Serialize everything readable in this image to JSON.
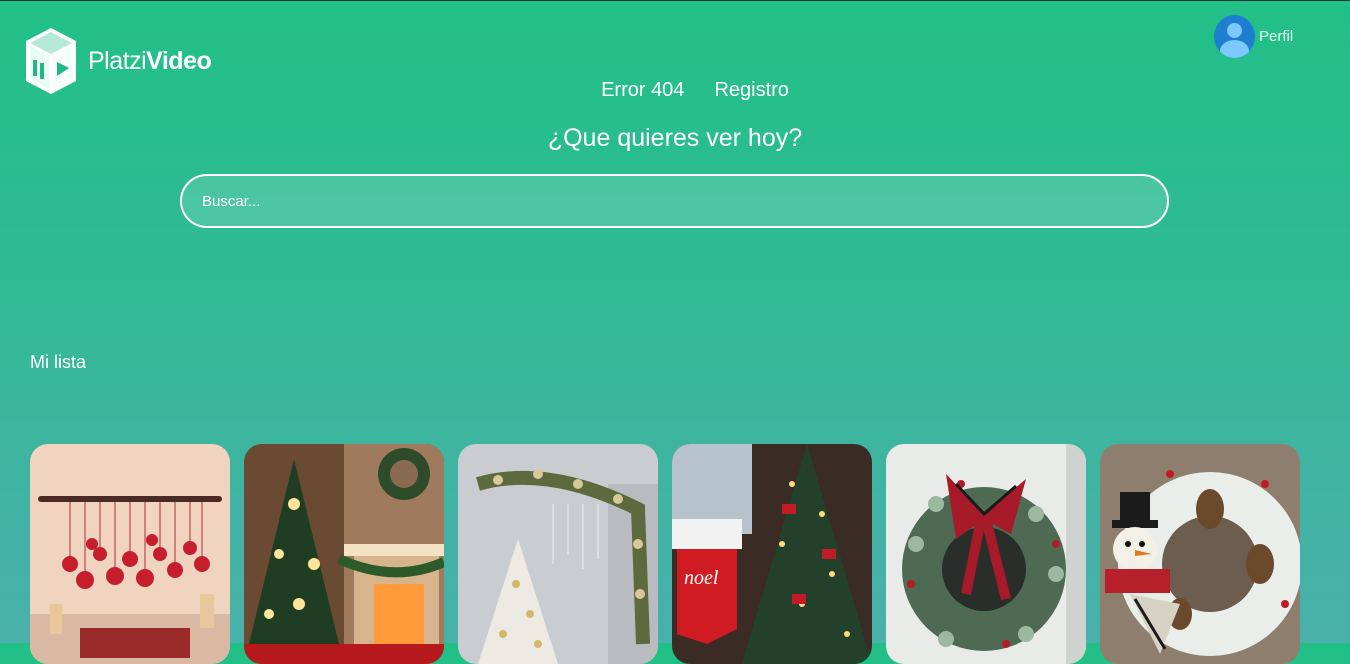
{
  "header": {
    "logo": {
      "text_light": "Platzi",
      "text_bold": "Video",
      "icon": "platzi-cube-icon"
    },
    "profile": {
      "label": "Perfil",
      "icon": "user-avatar-icon",
      "avatar_color": "#1e7fd0"
    }
  },
  "nav": {
    "items": [
      {
        "label": "Error 404"
      },
      {
        "label": "Registro"
      }
    ]
  },
  "hero": {
    "title": "¿Que quieres ver hoy?",
    "search_placeholder": "Buscar..."
  },
  "my_list": {
    "title": "Mi lista",
    "items": [
      {
        "subject": "red-ornaments-wall"
      },
      {
        "subject": "christmas-tree-fireplace"
      },
      {
        "subject": "white-christmas-tree-garland"
      },
      {
        "subject": "christmas-tree-noel-stocking"
      },
      {
        "subject": "plaid-ribbon-wreath"
      },
      {
        "subject": "snowman-wreath"
      }
    ]
  },
  "colors": {
    "gradient_top": "#21c087",
    "gradient_bottom": "#4ab0ab"
  }
}
